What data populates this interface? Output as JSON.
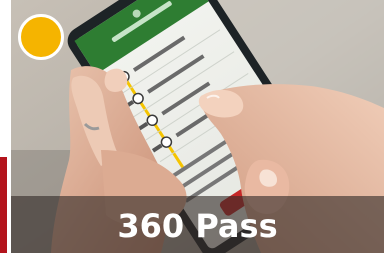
{
  "caption": {
    "title": "360 Pass"
  },
  "colors": {
    "badge": "#f5b400",
    "caption_overlay": "#342c28",
    "accent_red": "#b3141c",
    "app_green": "#2e7d32"
  },
  "icons": {
    "badge": "status-dot-icon"
  }
}
